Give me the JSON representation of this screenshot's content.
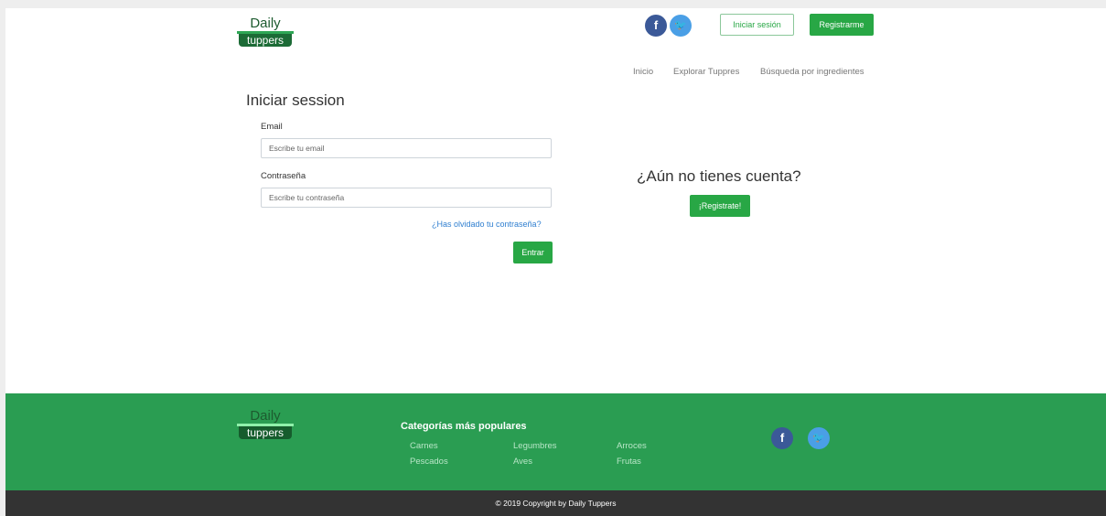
{
  "header": {
    "logo": {
      "line1": "Daily",
      "line2": "tuppers"
    },
    "social": {
      "facebook_glyph": "f",
      "twitter_glyph": "🐦"
    },
    "login_button": "Iniciar sesión",
    "register_button": "Registrarme",
    "nav": [
      "Inicio",
      "Explorar Tuppres",
      "Búsqueda por ingredientes"
    ]
  },
  "login": {
    "title": "Iniciar session",
    "email_label": "Email",
    "email_placeholder": "Escribe tu email",
    "password_label": "Contraseña",
    "password_placeholder": "Escribe tu contraseña",
    "forgot_link": "¿Has olvidado tu contraseña?",
    "submit": "Entrar"
  },
  "signup": {
    "title": "¿Aún no tienes cuenta?",
    "button": "¡Registrate!"
  },
  "footer": {
    "logo": {
      "line1": "Daily",
      "line2": "tuppers"
    },
    "categories_title": "Categorías más populares",
    "categories": [
      "Carnes",
      "Legumbres",
      "Arroces",
      "Pescados",
      "Aves",
      "Frutas"
    ],
    "copyright": "© 2019 Copyright by Daily Tuppers"
  },
  "colors": {
    "accent": "#28a745",
    "footer_bg": "#2a9d52",
    "copyright_bg": "#333333",
    "facebook": "#3b5998",
    "twitter": "#4a9fe6",
    "link": "#2f7fd0"
  }
}
